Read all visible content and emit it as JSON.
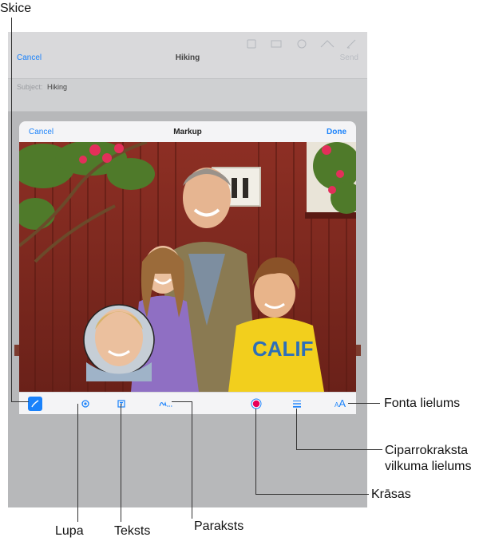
{
  "callouts": {
    "sketch": "Skice",
    "magnifier": "Lupa",
    "text": "Teksts",
    "signature": "Paraksts",
    "colors": "Krāsas",
    "line_width": "Ciparrokraksta vilkuma lielums",
    "line_width_line1": "Ciparrokraksta",
    "line_width_line2": "vilkuma lielums",
    "font_size": "Fonta lielums"
  },
  "mail": {
    "cancel_label": "Cancel",
    "title": "Hiking",
    "send_label": "Send",
    "subject_label": "Subject:",
    "subject_value": "Hiking"
  },
  "markup": {
    "cancel_label": "Cancel",
    "title": "Markup",
    "done_label": "Done",
    "font_size_glyph": "AA"
  },
  "colors": {
    "accent": "#1a82fb",
    "selected_color": "#e8005a"
  },
  "icons": {
    "sketch": "pen-icon",
    "magnifier": "magnifier-icon",
    "text": "text-box-icon",
    "signature": "signature-icon",
    "color": "color-swatch-icon",
    "line_width": "line-width-icon",
    "font_size": "font-size-icon"
  }
}
